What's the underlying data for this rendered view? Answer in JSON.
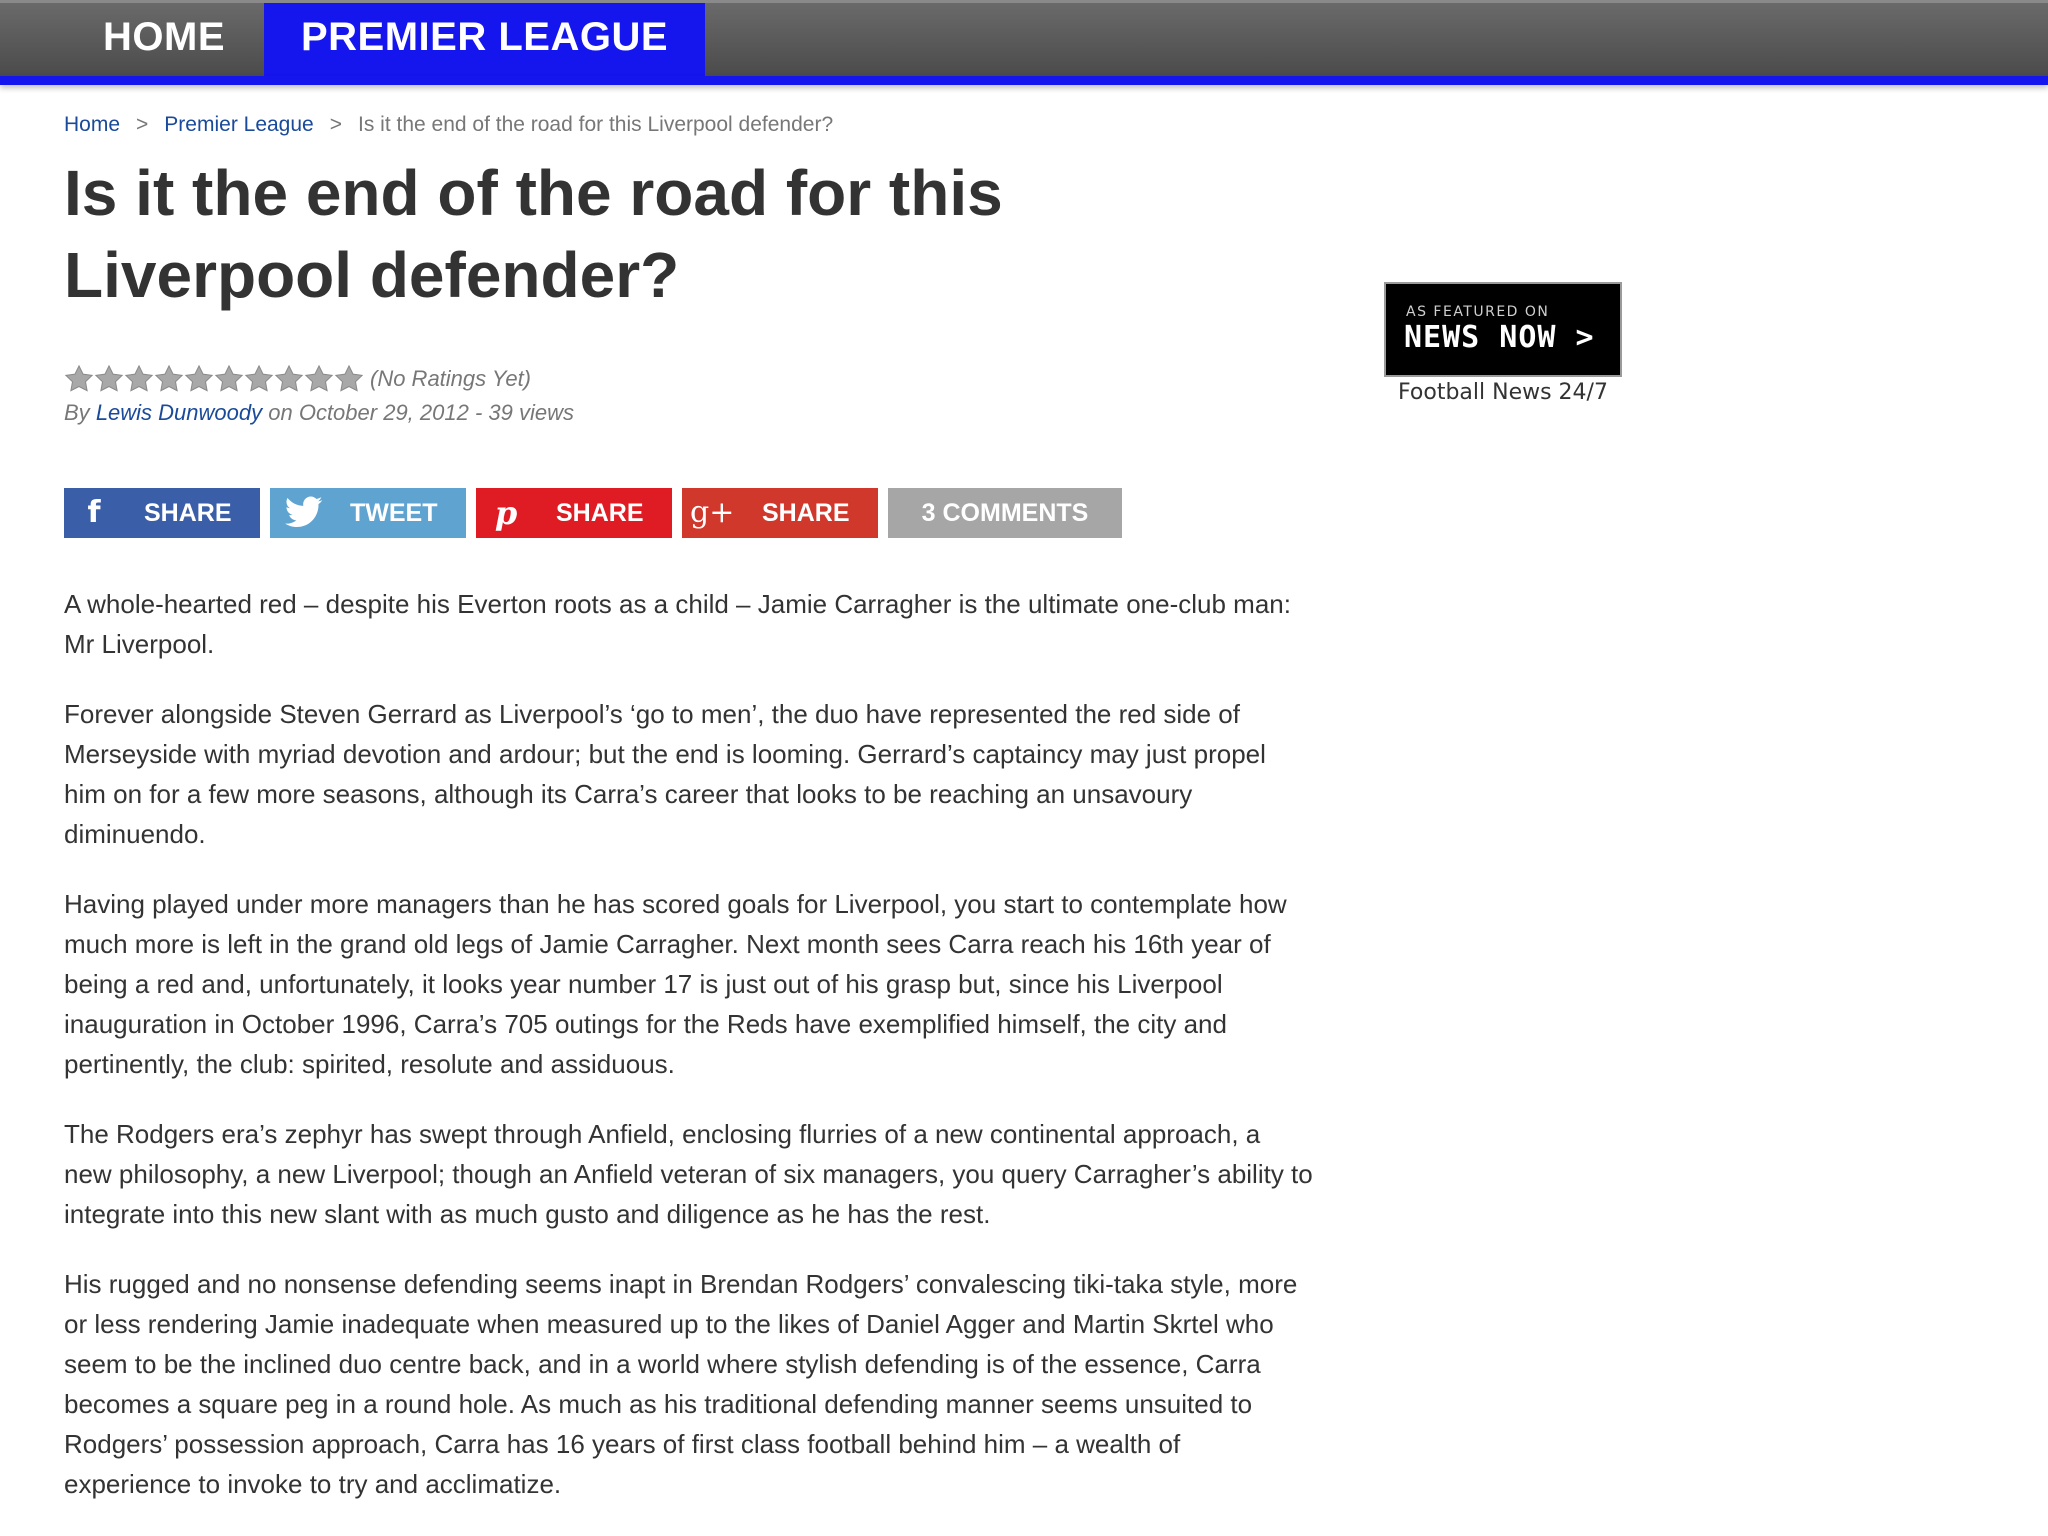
{
  "nav": {
    "home_label": "HOME",
    "premier_league_label": "PREMIER LEAGUE"
  },
  "breadcrumb": {
    "home": "Home",
    "separator": ">",
    "section": "Premier League",
    "current": "Is it the end of the road for this Liverpool defender?"
  },
  "article": {
    "title": "Is it the end of the road for this Liverpool defender?",
    "rating_text": "(No Ratings Yet)",
    "rating_value": 0,
    "rating_max": 10,
    "by_prefix": "By",
    "author": "Lewis Dunwoody",
    "date_views": "on October 29, 2012 - 39 views",
    "paragraphs": [
      "A whole-hearted red – despite his Everton roots as a child – Jamie Carragher is the ultimate one-club man: Mr Liverpool.",
      "Forever alongside Steven Gerrard as Liverpool’s ‘go to men’, the duo have represented the red side of Merseyside with myriad devotion and ardour; but the end is looming. Gerrard’s captaincy may just propel him on for a few more seasons, although its Carra’s career that looks to be reaching an unsavoury diminuendo.",
      "Having played under more managers than he has scored goals for Liverpool, you start to contemplate how much more is left in the grand old legs of Jamie Carragher. Next month sees Carra reach his 16th year of being a red and, unfortunately, it looks year number 17 is just out of his grasp but, since his Liverpool inauguration in October 1996, Carra’s 705 outings for the Reds have exemplified himself, the city and pertinently, the club: spirited, resolute and assiduous.",
      "The Rodgers era’s zephyr has swept through Anfield, enclosing flurries of a new continental approach, a new philosophy, a new Liverpool; though an Anfield veteran of six managers, you query Carragher’s ability to integrate into this new slant with as much gusto and diligence as he has the rest.",
      "His rugged and no nonsense defending seems inapt in Brendan Rodgers’ convalescing tiki-taka style, more or less rendering Jamie inadequate when measured up to the likes of Daniel Agger and Martin Skrtel who seem to be the inclined duo centre back, and in a world where stylish defending is of the essence, Carra becomes a square peg in a round hole. As much as his traditional defending manner seems unsuited to Rodgers’ possession approach, Carra has 16 years of first class football behind him – a wealth of experience to invoke to try and acclimatize."
    ]
  },
  "share": {
    "facebook_label": "SHARE",
    "facebook_icon": "f",
    "twitter_label": "TWEET",
    "pinterest_label": "SHARE",
    "pinterest_icon": "p",
    "googleplus_label": "SHARE",
    "googleplus_icon": "g+",
    "comments_label": "3 COMMENTS",
    "colors": {
      "facebook": "#3b5ea8",
      "twitter": "#5fa3d0",
      "pinterest": "#df1c24",
      "googleplus": "#d0382c",
      "comments": "#a6a6a6"
    }
  },
  "sidebar": {
    "badge_small": "AS FEATURED ON",
    "badge_big": "NEWS NOW >",
    "caption": "Football News 24/7"
  },
  "colors": {
    "nav_background": "#555555",
    "accent_blue": "#1515ee",
    "link": "#1a4a9a"
  }
}
